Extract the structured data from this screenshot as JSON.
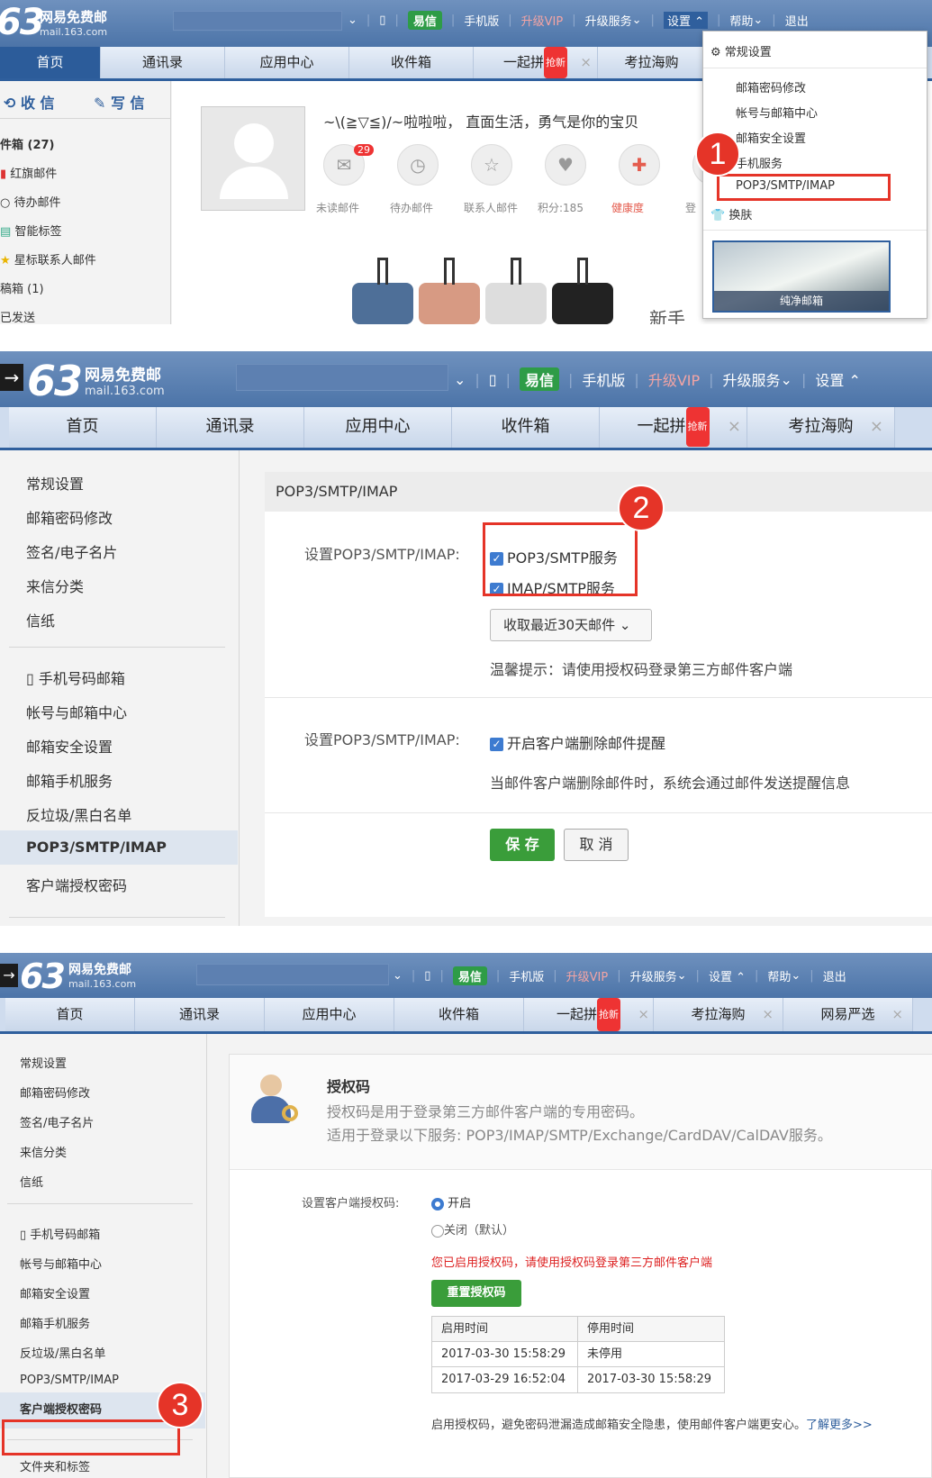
{
  "header": {
    "logo_num": "63",
    "brand": "网易免费邮",
    "domain": "mail.163.com",
    "yixin": "易信",
    "mobile": "手机版",
    "vip": "升级VIP",
    "upgrade": "升级服务",
    "settings": "设置",
    "help": "帮助",
    "logout": "退出"
  },
  "tabs": {
    "home": "首页",
    "contacts": "通讯录",
    "apps": "应用中心",
    "inbox": "收件箱",
    "group": "一起拼",
    "group_badge": "抢新",
    "kaola": "考拉海购",
    "yanxuan": "网易严选"
  },
  "p1": {
    "receive": "收 信",
    "compose": "写 信",
    "folders": [
      "件箱 (27)",
      "红旗邮件",
      "待办邮件",
      "智能标签",
      "星标联系人邮件",
      "稿箱 (1)",
      "已发送"
    ],
    "greeting": "~\\(≧▽≦)/~啦啦啦， 直面生活，勇气是你的宝贝",
    "unread_count": "29",
    "shortcuts": [
      "未读邮件",
      "待办邮件",
      "联系人邮件",
      "积分:185",
      "健康度",
      "登"
    ],
    "menu": [
      "常规设置",
      "邮箱密码修改",
      "帐号与邮箱中心",
      "邮箱安全设置",
      "手机服务",
      "POP3/SMTP/IMAP",
      "换肤"
    ],
    "skin": "纯净邮箱",
    "banner": "新手"
  },
  "p2": {
    "side": [
      "常规设置",
      "邮箱密码修改",
      "签名/电子名片",
      "来信分类",
      "信纸",
      "手机号码邮箱",
      "帐号与邮箱中心",
      "邮箱安全设置",
      "邮箱手机服务",
      "反垃圾/黑白名单",
      "POP3/SMTP/IMAP",
      "客户端授权密码"
    ],
    "section_title": "POP3/SMTP/IMAP",
    "label1": "设置POP3/SMTP/IMAP:",
    "opt_pop3": "POP3/SMTP服务",
    "opt_imap": "IMAP/SMTP服务",
    "select": "收取最近30天邮件",
    "tip": "温馨提示：请使用授权码登录第三方邮件客户端",
    "label2": "设置POP3/SMTP/IMAP:",
    "opt_delete": "开启客户端删除邮件提醒",
    "delete_desc": "当邮件客户端删除邮件时，系统会通过邮件发送提醒信息",
    "save": "保 存",
    "cancel": "取 消"
  },
  "p3": {
    "side": [
      "常规设置",
      "邮箱密码修改",
      "签名/电子名片",
      "来信分类",
      "信纸",
      "手机号码邮箱",
      "帐号与邮箱中心",
      "邮箱安全设置",
      "邮箱手机服务",
      "反垃圾/黑白名单",
      "POP3/SMTP/IMAP",
      "客户端授权密码",
      "文件夹和标签"
    ],
    "auth_title": "授权码",
    "auth_desc1": "授权码是用于登录第三方邮件客户端的专用密码。",
    "auth_desc2": "适用于登录以下服务: POP3/IMAP/SMTP/Exchange/CardDAV/CalDAV服务。",
    "set_label": "设置客户端授权码:",
    "on": "开启",
    "off": "关闭（默认）",
    "enabled_msg": "您已启用授权码，请使用授权码登录第三方邮件客户端",
    "reset": "重置授权码",
    "table_headers": [
      "启用时间",
      "停用时间"
    ],
    "table_rows": [
      [
        "2017-03-30 15:58:29",
        "未停用"
      ],
      [
        "2017-03-29 16:52:04",
        "2017-03-30 15:58:29"
      ]
    ],
    "footer": "启用授权码，避免密码泄漏造成邮箱安全隐患，使用邮件客户端更安心。",
    "learn_more": "了解更多>>"
  },
  "callouts": [
    "1",
    "2",
    "3"
  ],
  "colors": {
    "callout": "#e53428",
    "header": "#4c74a8",
    "save": "#3a9d3a"
  }
}
